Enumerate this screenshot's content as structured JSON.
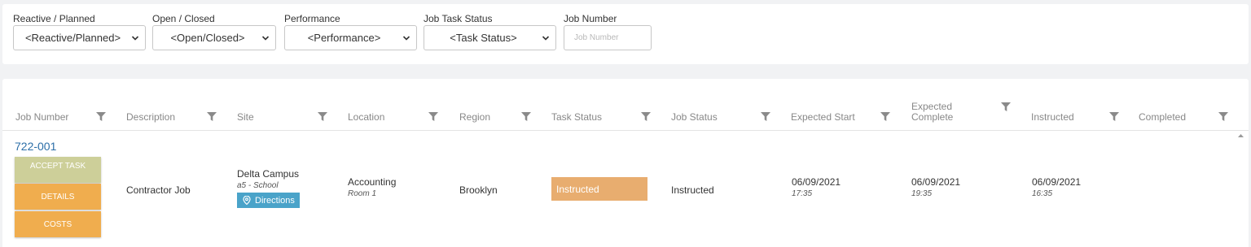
{
  "filters": {
    "reactive_label": "Reactive / Planned",
    "reactive_value": "<Reactive/Planned>",
    "open_label": "Open / Closed",
    "open_value": "<Open/Closed>",
    "performance_label": "Performance",
    "performance_value": "<Performance>",
    "task_status_label": "Job Task Status",
    "task_status_value": "<Task Status>",
    "job_number_label": "Job Number",
    "job_number_placeholder": "Job Number"
  },
  "columns": {
    "job_number": "Job Number",
    "description": "Description",
    "site": "Site",
    "location": "Location",
    "region": "Region",
    "task_status": "Task Status",
    "job_status": "Job Status",
    "expected_start": "Expected Start",
    "expected_complete_1": "Expected",
    "expected_complete_2": "Complete",
    "instructed": "Instructed",
    "completed": "Completed"
  },
  "row": {
    "job_number": "722-001",
    "accept_label": "ACCEPT TASK",
    "details_label": "DETAILS",
    "costs_label": "COSTS",
    "description": "Contractor Job",
    "site_name": "Delta Campus",
    "site_sub": "a5 - School",
    "directions_label": "Directions",
    "location": "Accounting",
    "location_sub": "Room 1",
    "region": "Brooklyn",
    "task_status": "Instructed",
    "job_status": "Instructed",
    "expected_start_date": "06/09/2021",
    "expected_start_time": "17:35",
    "expected_complete_date": "06/09/2021",
    "expected_complete_time": "19:35",
    "instructed_date": "06/09/2021",
    "instructed_time": "16:35",
    "completed": ""
  },
  "colors": {
    "accent_link": "#2d6fa8",
    "accept_button": "#cdcf99",
    "action_button": "#f0ad4e",
    "task_status_badge": "#e8ad6f",
    "directions_button": "#4aa3c9"
  },
  "icons": {
    "filter": "filter-icon",
    "select": "chevron-down-icon",
    "directions": "map-pin-icon",
    "scroll": "scroll-up-icon"
  }
}
